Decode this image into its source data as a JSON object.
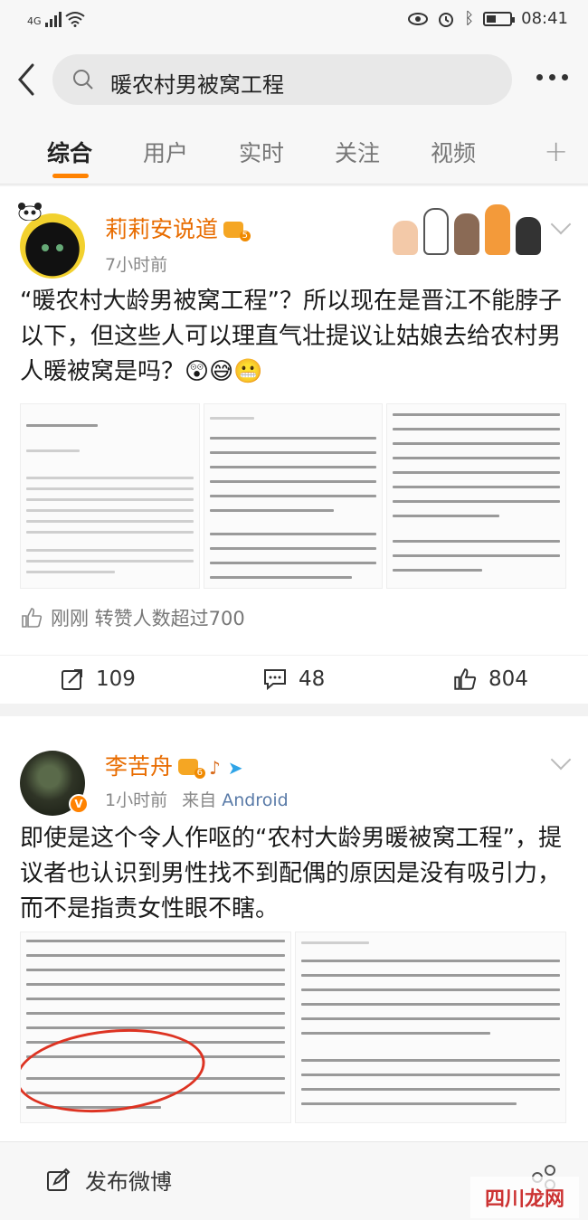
{
  "status_bar": {
    "network": "4G",
    "time": "08:41"
  },
  "search": {
    "query": "暖农村男被窝工程"
  },
  "tabs": [
    {
      "label": "综合",
      "active": true
    },
    {
      "label": "用户",
      "active": false
    },
    {
      "label": "实时",
      "active": false
    },
    {
      "label": "关注",
      "active": false
    },
    {
      "label": "视频",
      "active": false
    }
  ],
  "posts": [
    {
      "author": "莉莉安说道",
      "level": "5",
      "time": "7小时前",
      "text": "“暖农村大龄男被窝工程”？所以现在是晋江不能脖子以下，但这些人可以理直气壮提议让姑娘去给农村男人暖被窝是吗？😲😅😬",
      "forward_note": "刚刚 转赞人数超过700",
      "reposts": "109",
      "comments": "48",
      "likes": "804"
    },
    {
      "author": "李苦舟",
      "level": "6",
      "time": "1小时前",
      "from_label": "来自",
      "source": "Android",
      "text": "即使是这个令人作呕的“农村大龄男暖被窝工程”，提议者也认识到男性找不到配偶的原因是没有吸引力，而不是指责女性眼不瞎。"
    }
  ],
  "bottom_bar": {
    "compose_label": "发布微博"
  },
  "watermark": "四川龙网",
  "colors": {
    "accent": "#ff8200",
    "username": "#e86c00",
    "link": "#5a7ba8"
  }
}
